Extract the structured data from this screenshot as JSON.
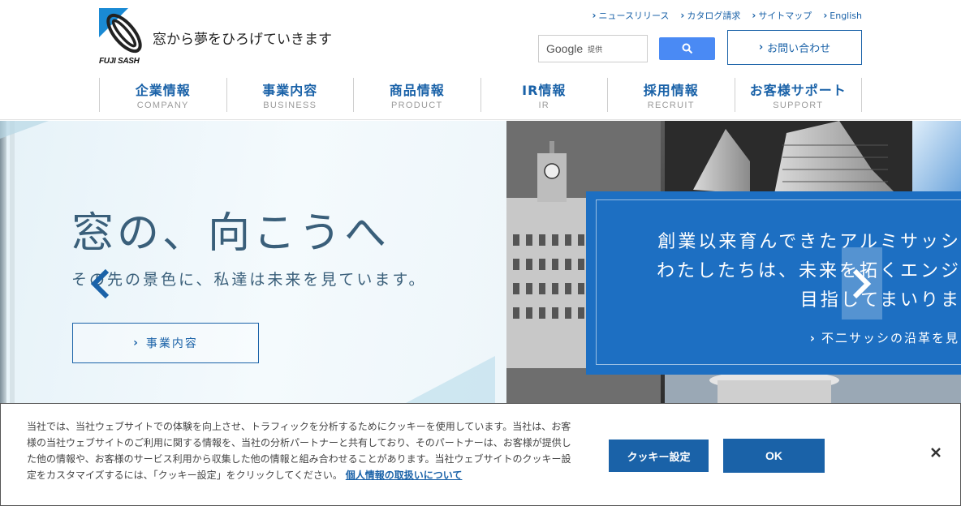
{
  "header": {
    "logo_text": "FUJI SASH",
    "tagline": "窓から夢をひろげていきます",
    "util_links": [
      {
        "label": "ニュースリリース"
      },
      {
        "label": "カタログ請求"
      },
      {
        "label": "サイトマップ"
      },
      {
        "label": "English"
      }
    ],
    "search": {
      "brand": "Google",
      "sub": "提供"
    },
    "contact_label": "お問い合わせ",
    "nav": [
      {
        "ja": "企業情報",
        "en": "COMPANY"
      },
      {
        "ja": "事業内容",
        "en": "BUSINESS"
      },
      {
        "ja": "商品情報",
        "en": "PRODUCT"
      },
      {
        "ja": "IR情報",
        "en": "IR"
      },
      {
        "ja": "採用情報",
        "en": "RECRUIT"
      },
      {
        "ja": "お客様サポート",
        "en": "SUPPORT"
      }
    ]
  },
  "hero": {
    "title": "窓の、向こうへ",
    "subtitle": "その先の景色に、私達は未来を見ています。",
    "button_label": "事業内容",
    "panel_lines": [
      "創業以来育んできたアルミサッシ",
      "わたしたちは、未来を拓くエンジ",
      "目指してまいりま"
    ],
    "panel_link": "不二サッシの沿革を見"
  },
  "cookie": {
    "text": "当社では、当社ウェブサイトでの体験を向上させ、トラフィックを分析するためにクッキーを使用しています。当社は、お客様の当社ウェブサイトのご利用に関する情報を、当社の分析パートナーと共有しており、そのパートナーは、お客様が提供した他の情報や、お客様のサービス利用から収集した他の情報と組み合わせることがあります。当社ウェブサイトのクッキー設定をカスタマイズするには、「クッキー設定」をクリックしてください。",
    "policy_link": "個人情報の取扱いについて",
    "settings_label": "クッキー設定",
    "ok_label": "OK",
    "close_symbol": "×"
  },
  "colors": {
    "brand_blue": "#1a62a8",
    "panel_blue": "#1d6fc2",
    "search_blue": "#4a8af4"
  }
}
